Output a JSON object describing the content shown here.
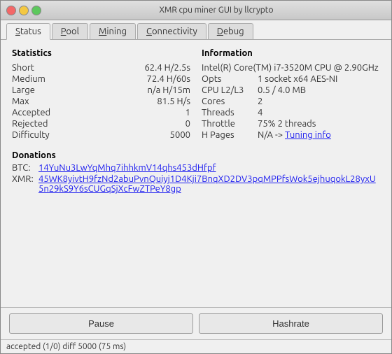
{
  "window": {
    "title": "XMR cpu miner GUI by llcrypto"
  },
  "tabs": [
    {
      "id": "status",
      "label": "Status",
      "active": true,
      "underline": "S"
    },
    {
      "id": "pool",
      "label": "Pool",
      "active": false,
      "underline": "P"
    },
    {
      "id": "mining",
      "label": "Mining",
      "active": false,
      "underline": "M"
    },
    {
      "id": "connectivity",
      "label": "Connectivity",
      "active": false,
      "underline": "C"
    },
    {
      "id": "debug",
      "label": "Debug",
      "active": false,
      "underline": "D"
    }
  ],
  "statistics": {
    "title": "Statistics",
    "rows": [
      {
        "label": "Short",
        "value": "62.4 H/2.5s"
      },
      {
        "label": "Medium",
        "value": "72.4 H/60s"
      },
      {
        "label": "Large",
        "value": "n/a H/15m"
      },
      {
        "label": "Max",
        "value": "81.5 H/s"
      },
      {
        "label": "Accepted",
        "value": "1"
      },
      {
        "label": "Rejected",
        "value": "0"
      },
      {
        "label": "Difficulty",
        "value": "5000"
      }
    ]
  },
  "information": {
    "title": "Information",
    "rows": [
      {
        "label": "Intel(R) Core(TM) i7-3520M CPU @ 2.90GHz",
        "type": "cpu"
      },
      {
        "label": "Opts",
        "value": "1 socket x64 AES-NI"
      },
      {
        "label": "CPU L2/L3",
        "value": "0.5 / 4.0 MB"
      },
      {
        "label": "Cores",
        "value": "2"
      },
      {
        "label": "Threads",
        "value": "4"
      },
      {
        "label": "Throttle",
        "value": "75% 2 threads"
      },
      {
        "label": "H Pages",
        "value": "N/A ->",
        "link": "Tuning info"
      }
    ]
  },
  "donations": {
    "title": "Donations",
    "btc_label": "BTC:",
    "btc_address": "14YuNu3LwYqMhq7ihhkmV14qhs453dHfpf",
    "xmr_label": "XMR:",
    "xmr_address": "45WK8yivtH9fzNd2abuPvnQuiyj1D4Kji7BnqXD2DV3pqMPPfsWok5ejhuqokL28yxU5n29kS9Y6sCUGqSjXcFwZTPeY8gp"
  },
  "buttons": {
    "pause": "Pause",
    "hashrate": "Hashrate"
  },
  "statusbar": {
    "text": "accepted (1/0) diff 5000 (75 ms)"
  }
}
